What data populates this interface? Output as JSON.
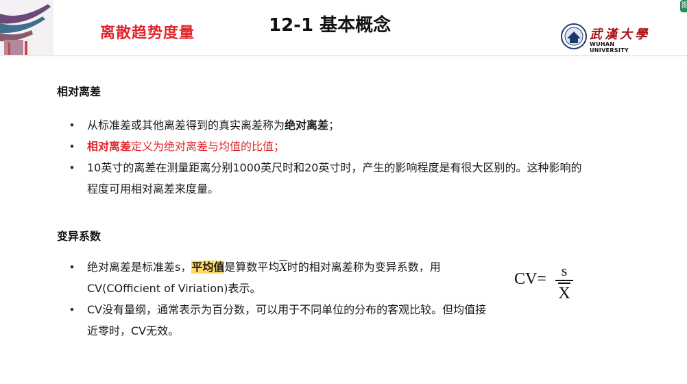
{
  "header": {
    "section_title": "离散趋势度量",
    "slide_title": "12-1 基本概念",
    "logo_cn": "武漢大學",
    "logo_en": "WUHAN UNIVERSITY",
    "corner_widget": "图"
  },
  "section1": {
    "heading": "相对离差",
    "bullets": [
      {
        "pre": "从标准差或其他离差得到的真实离差称为",
        "bold": "绝对离差",
        "post": "；"
      },
      {
        "bold": "相对离差",
        "post": "定义为绝对离差与均值的比值；"
      },
      {
        "text": "10英寸的离差在测量距离分别1000英尺时和20英寸时，产生的影响程度是有很大区别的。这种影响的程度可用相对离差来度量。"
      }
    ]
  },
  "section2": {
    "heading": "变异系数",
    "bullets": [
      {
        "pre": "绝对离差是标准差s，",
        "highlight": "平均值",
        "mid": "是算数平均",
        "xbar": "X",
        "post": "时的相对离差称为变异系数，用CV(COfficient of Viriation)表示。"
      },
      {
        "text": "CV没有量纲，通常表示为百分数，可以用于不同单位的分布的客观比较。但均值接近零时，CV无效。"
      }
    ]
  },
  "formula": {
    "lhs": "CV=",
    "numerator": "s",
    "denominator": "X"
  },
  "colors": {
    "accent_red": "#e0262a",
    "highlight": "#ffd966"
  }
}
